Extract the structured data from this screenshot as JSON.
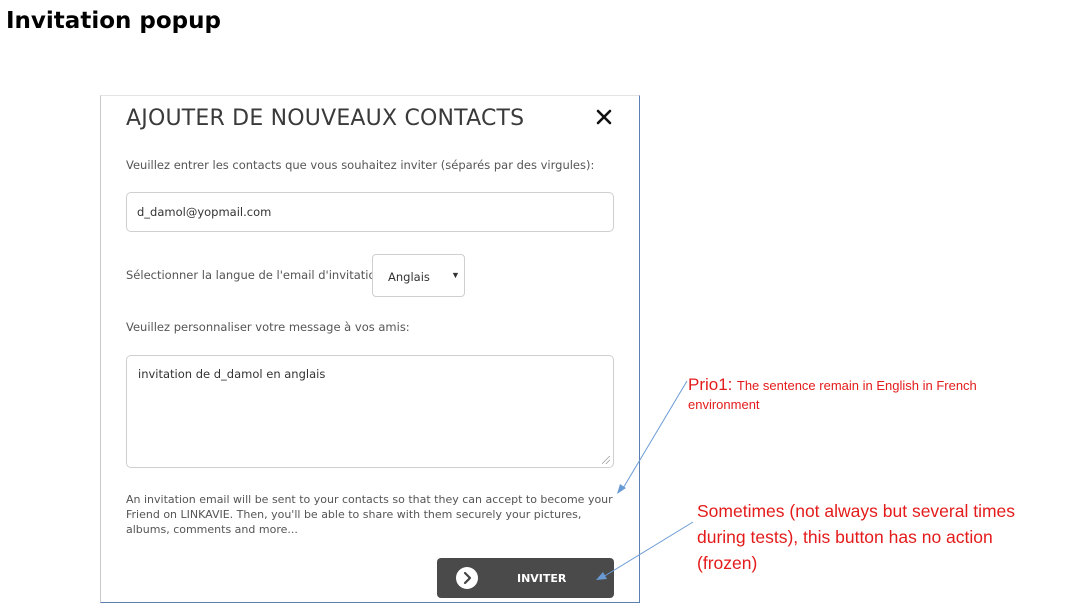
{
  "page": {
    "title": "Invitation popup"
  },
  "modal": {
    "title": "AJOUTER DE NOUVEAUX CONTACTS",
    "contacts_label": "Veuillez entrer les contacts que vous souhaitez inviter (séparés par des virgules):",
    "contacts_value": "d_damol@yopmail.com",
    "language_label": "Sélectionner la langue de l'email d'invitation:",
    "language_selected": "Anglais",
    "message_label": "Veuillez personnaliser votre message à vos amis:",
    "message_value": "invitation de d_damol en anglais",
    "info_text": "An invitation email will be sent to your contacts so that they can accept to become your Friend on LINKAVIE. Then, you'll be able to share with them securely your pictures, albums, comments and more...",
    "invite_label": "INVITER",
    "icons": {
      "close": "close-icon",
      "caret": "caret-down-icon",
      "invite": "chevron-right-circle-icon"
    }
  },
  "annotations": {
    "prio_label": "Prio1:",
    "prio_text": "The sentence remain in English in French",
    "prio_text_2": "environment",
    "frozen_text": "Sometimes (not always but several times during tests), this button has no action (frozen)",
    "color": "#e41b1b",
    "arrow_color": "#6a9ad4"
  }
}
